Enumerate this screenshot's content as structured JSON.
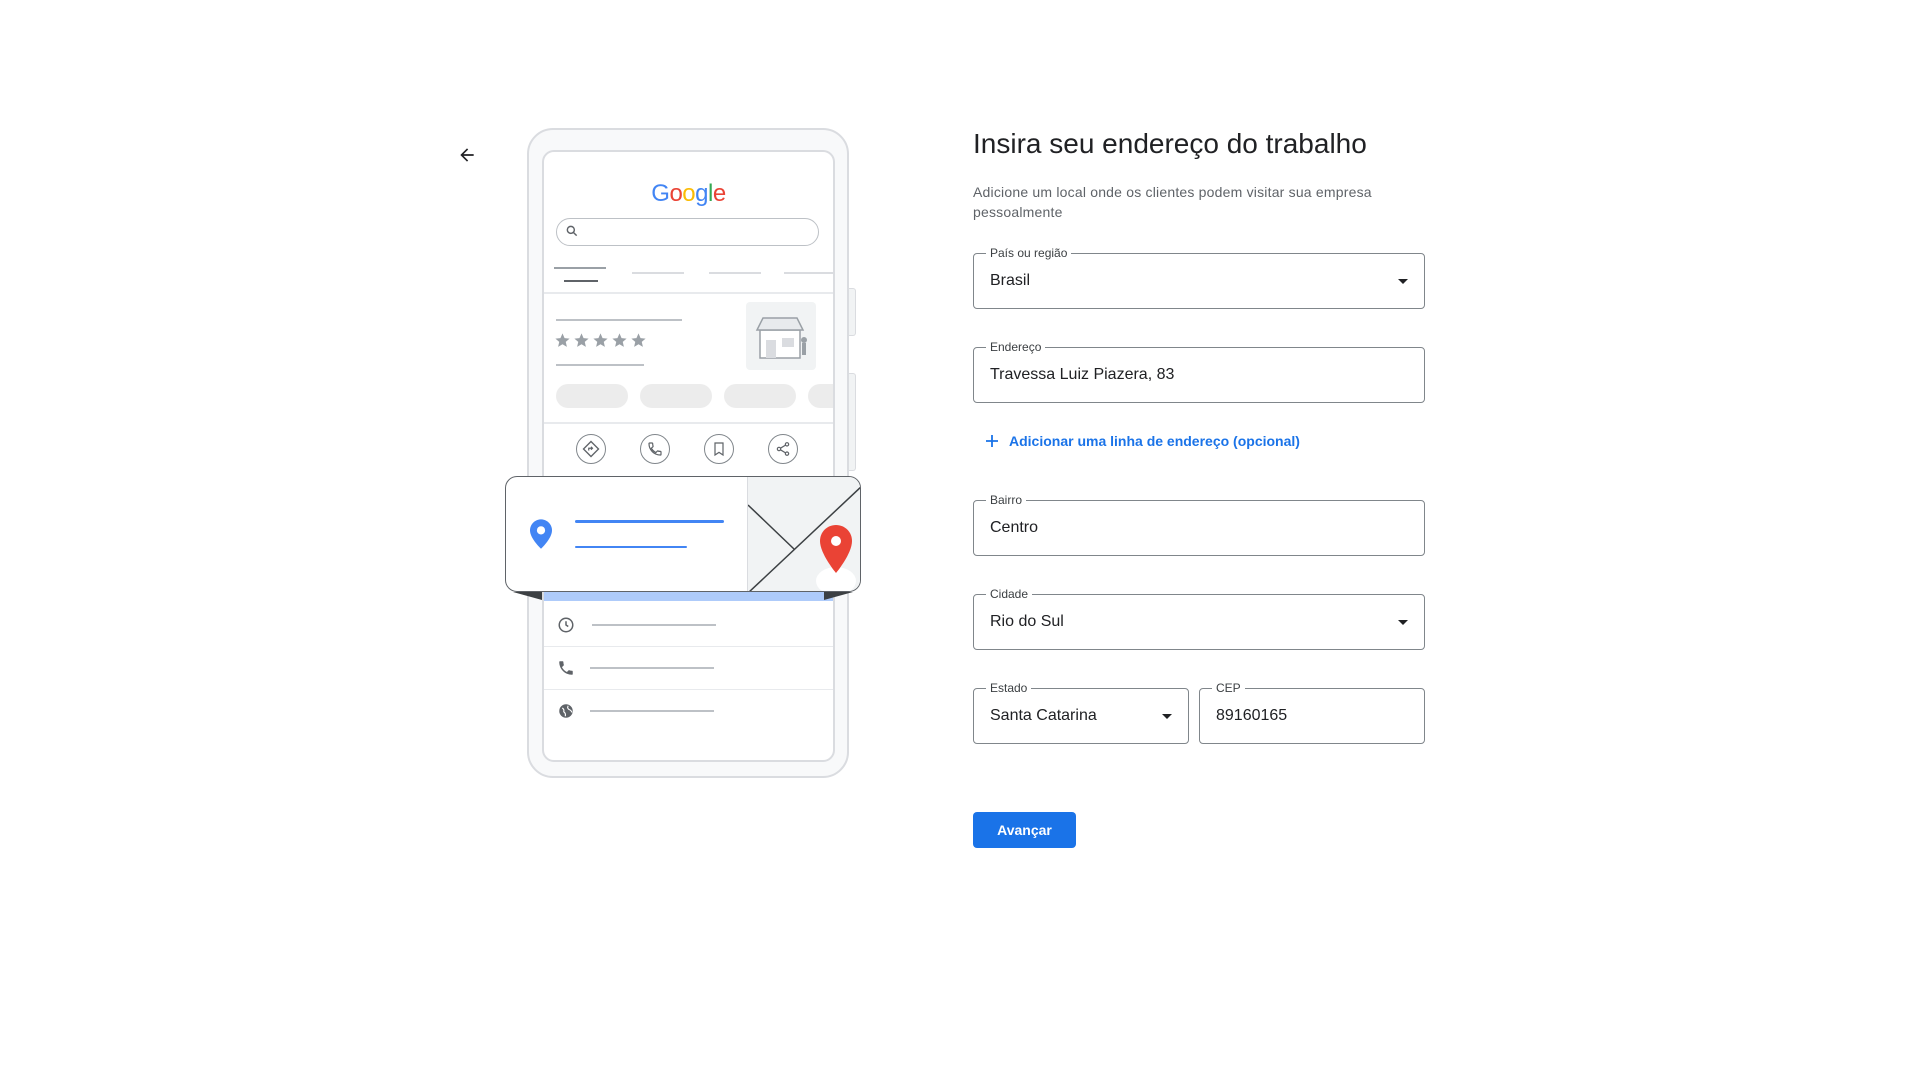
{
  "page": {
    "title": "Insira seu endereço do trabalho",
    "subtitle": "Adicione um local onde os clientes podem visitar sua empresa pessoalmente"
  },
  "illustration": {
    "logo_letters": [
      {
        "char": "G",
        "color": "#4285F4"
      },
      {
        "char": "o",
        "color": "#EA4335"
      },
      {
        "char": "o",
        "color": "#FBBC05"
      },
      {
        "char": "g",
        "color": "#4285F4"
      },
      {
        "char": "l",
        "color": "#34A853"
      },
      {
        "char": "e",
        "color": "#EA4335"
      }
    ],
    "rating_stars": 5,
    "icons": [
      "search-icon",
      "store-icon",
      "directions-icon",
      "phone-icon",
      "bookmark-icon",
      "share-icon",
      "location-pin-icon",
      "map-pin-icon",
      "clock-icon",
      "globe-icon"
    ]
  },
  "form": {
    "country": {
      "label": "País ou região",
      "value": "Brasil"
    },
    "address": {
      "label": "Endereço",
      "value": "Travessa Luiz Piazera, 83"
    },
    "add_line": {
      "label": "Adicionar uma linha de endereço (opcional)"
    },
    "neighborhood": {
      "label": "Bairro",
      "value": "Centro"
    },
    "city": {
      "label": "Cidade",
      "value": "Rio do Sul"
    },
    "state": {
      "label": "Estado",
      "value": "Santa Catarina"
    },
    "zip": {
      "label": "CEP",
      "value": "89160165"
    },
    "next_button": "Avançar"
  },
  "colors": {
    "accent": "#1a73e8",
    "text": "#202124",
    "secondary_text": "#5f6368",
    "border": "#80868b",
    "map_pin": "#EA4335",
    "location_pin": "#4285F4"
  }
}
